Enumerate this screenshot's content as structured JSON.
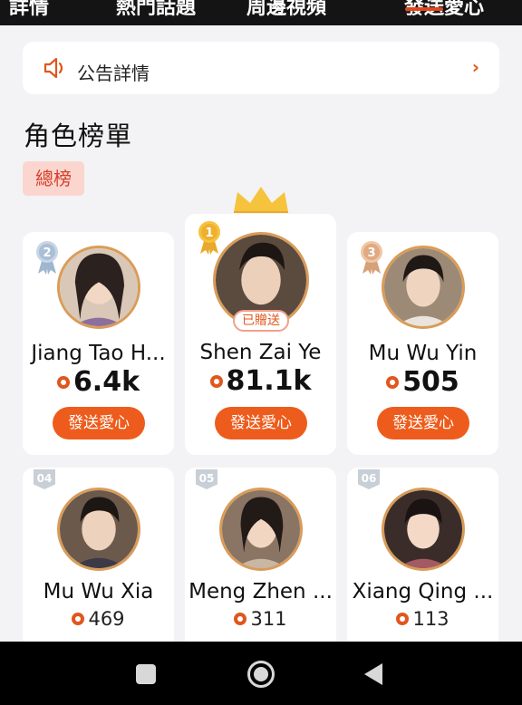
{
  "top_tabs": [
    {
      "label": "詳情"
    },
    {
      "label": "熱門話題"
    },
    {
      "label": "周邊視頻"
    },
    {
      "label": "發送愛心",
      "active": true
    }
  ],
  "announcement": {
    "label": "公告詳情",
    "icon": "speaker-icon",
    "chevron": "›"
  },
  "section_title": "角色榜單",
  "filter_chip": "總榜",
  "gift_tag": "已贈送",
  "accent_color": "#ed5c1c",
  "characters": [
    {
      "rank": "1",
      "name": "Shen Zai Ye",
      "score": "81.1k",
      "button": "發送愛心"
    },
    {
      "rank": "2",
      "name": "Jiang Tao H...",
      "score": "6.4k",
      "button": "發送愛心"
    },
    {
      "rank": "3",
      "name": "Mu Wu Yin",
      "score": "505",
      "button": "發送愛心"
    },
    {
      "rank": "04",
      "name": "Mu Wu Xia",
      "score": "469"
    },
    {
      "rank": "05",
      "name": "Meng Zhen ...",
      "score": "311"
    },
    {
      "rank": "06",
      "name": "Xiang Qing ...",
      "score": "113"
    }
  ]
}
